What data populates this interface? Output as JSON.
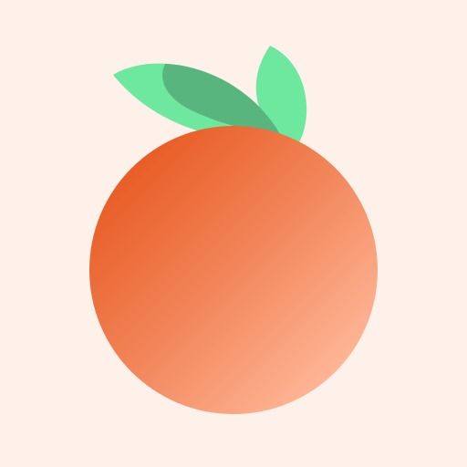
{
  "icon": "orange-fruit-icon",
  "colors": {
    "background": "#FEF1EA",
    "fruit_gradient_start": "#E85A22",
    "fruit_gradient_mid": "#F2865A",
    "fruit_gradient_end": "#FFB89A",
    "leaf_light": "#6EE89E",
    "leaf_dark": "#58B57E"
  }
}
